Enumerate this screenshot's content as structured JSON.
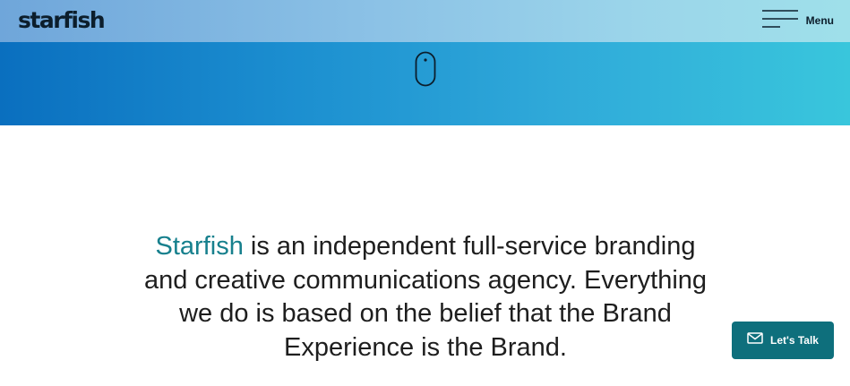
{
  "header": {
    "logo": "starfish",
    "menu_label": "Menu",
    "menu_icon": "hamburger-icon"
  },
  "hero": {
    "scroll_icon": "mouse-scroll-icon",
    "background_gradient": [
      "#0a6fbf",
      "#39c6dc"
    ]
  },
  "intro": {
    "brand": "Starfish",
    "text": " is an independent full-service branding and creative communications agency. Everything we do is based on the belief that the Brand Experience is the Brand."
  },
  "cta": {
    "label": "Let's Talk",
    "icon": "mail-icon",
    "color": "#0e6f7c"
  },
  "colors": {
    "accent": "#17808d",
    "text": "#1e1e1e"
  }
}
